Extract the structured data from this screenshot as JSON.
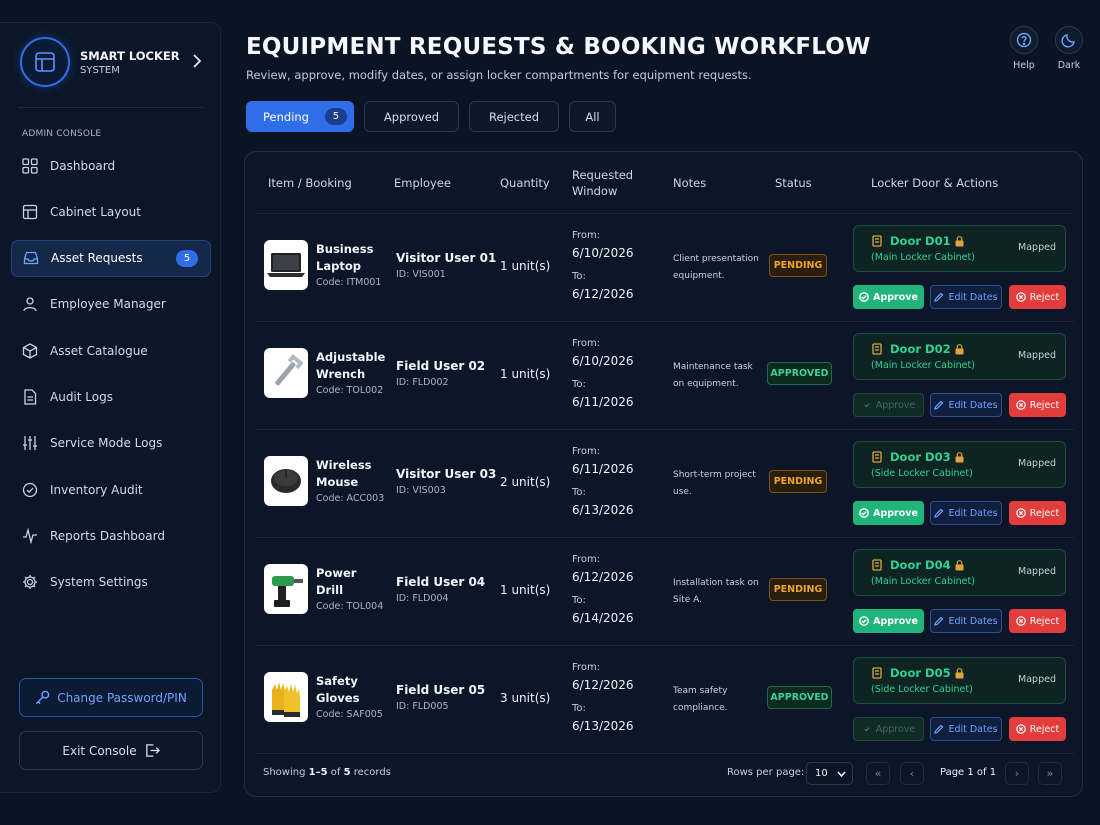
{
  "sidebar": {
    "brand_title": "SMART LOCKER",
    "brand_sub": "SYSTEM",
    "section_label": "ADMIN CONSOLE",
    "items": [
      {
        "label": "Dashboard",
        "icon": "grid-icon"
      },
      {
        "label": "Cabinet Layout",
        "icon": "cabinet-icon"
      },
      {
        "label": "Asset Requests",
        "icon": "inbox-icon",
        "badge": "5",
        "active": true
      },
      {
        "label": "Employee Manager",
        "icon": "user-icon"
      },
      {
        "label": "Asset Catalogue",
        "icon": "box-icon"
      },
      {
        "label": "Audit Logs",
        "icon": "document-icon"
      },
      {
        "label": "Service Mode Logs",
        "icon": "sliders-icon"
      },
      {
        "label": "Inventory Audit",
        "icon": "check-circle-icon"
      },
      {
        "label": "Reports Dashboard",
        "icon": "activity-icon"
      },
      {
        "label": "System Settings",
        "icon": "gear-icon"
      }
    ],
    "change_password_label": "Change Password/PIN",
    "exit_label": "Exit Console"
  },
  "header": {
    "title": "EQUIPMENT REQUESTS & BOOKING WORKFLOW",
    "subtitle": "Review, approve, modify dates, or assign locker compartments for equipment requests.",
    "help_label": "Help",
    "dark_label": "Dark"
  },
  "tabs": [
    {
      "label": "Pending",
      "count": "5",
      "active": true
    },
    {
      "label": "Approved"
    },
    {
      "label": "Rejected"
    },
    {
      "label": "All"
    }
  ],
  "table": {
    "columns": [
      "Item / Booking",
      "Employee",
      "Quantity",
      "Requested Window",
      "Notes",
      "Status",
      "Locker Door & Actions"
    ],
    "from_label": "From:",
    "to_label": "To:",
    "mapped_label": "Mapped",
    "approve_label": "Approve",
    "edit_label": "Edit Dates",
    "reject_label": "Reject",
    "rows": [
      {
        "item": "Business Laptop",
        "code": "Code: ITM001",
        "employee": "Visitor User 01",
        "emp_id": "ID: VIS001",
        "quantity": "1 unit(s)",
        "from": "6/10/2026",
        "to": "6/12/2026",
        "notes": "Client presentation equipment.",
        "status": "PENDING",
        "door": "Door D01",
        "cabinet": "(Main Locker Cabinet)",
        "thumb": "laptop-icon"
      },
      {
        "item": "Adjustable Wrench",
        "code": "Code: TOL002",
        "employee": "Field User 02",
        "emp_id": "ID: FLD002",
        "quantity": "1 unit(s)",
        "from": "6/10/2026",
        "to": "6/11/2026",
        "notes": "Maintenance task on equipment.",
        "status": "APPROVED",
        "door": "Door D02",
        "cabinet": "(Main Locker Cabinet)",
        "thumb": "wrench-icon"
      },
      {
        "item": "Wireless Mouse",
        "code": "Code: ACC003",
        "employee": "Visitor User 03",
        "emp_id": "ID: VIS003",
        "quantity": "2 unit(s)",
        "from": "6/11/2026",
        "to": "6/13/2026",
        "notes": "Short-term project use.",
        "status": "PENDING",
        "door": "Door D03",
        "cabinet": "(Side Locker Cabinet)",
        "thumb": "mouse-icon"
      },
      {
        "item": "Power Drill",
        "code": "Code: TOL004",
        "employee": "Field User 04",
        "emp_id": "ID: FLD004",
        "quantity": "1 unit(s)",
        "from": "6/12/2026",
        "to": "6/14/2026",
        "notes": "Installation task on Site A.",
        "status": "PENDING",
        "door": "Door D04",
        "cabinet": "(Main Locker Cabinet)",
        "thumb": "drill-icon"
      },
      {
        "item": "Safety Gloves",
        "code": "Code: SAF005",
        "employee": "Field User 05",
        "emp_id": "ID: FLD005",
        "quantity": "3 unit(s)",
        "from": "6/12/2026",
        "to": "6/13/2026",
        "notes": "Team safety compliance.",
        "status": "APPROVED",
        "door": "Door D05",
        "cabinet": "(Side Locker Cabinet)",
        "thumb": "gloves-icon"
      }
    ]
  },
  "footer": {
    "showing_prefix": "Showing",
    "showing_range": "1–5",
    "showing_of": "of",
    "showing_total": "5",
    "showing_suffix": "records",
    "rows_per_page_label": "Rows per page:",
    "rows_per_page_value": "10",
    "page_label": "Page 1 of 1"
  },
  "colors": {
    "accent": "#2f6ee8",
    "pending": "#f0a431",
    "approved": "#3fd09a",
    "reject": "#e23c3c",
    "approve_button": "#1fb47a"
  }
}
